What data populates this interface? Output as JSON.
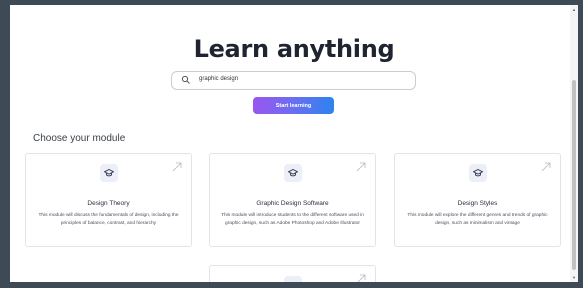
{
  "hero": {
    "title": "Learn anything"
  },
  "search": {
    "value": "graphic design",
    "icon": "search-icon"
  },
  "actions": {
    "start_label": "Start learning"
  },
  "section": {
    "title": "Choose your module"
  },
  "modules": [
    {
      "title": "Design Theory",
      "description": "This module will discuss the fundamentals of design, including the principles of balance, contrast, and hierarchy",
      "icon": "graduation-cap-icon"
    },
    {
      "title": "Graphic Design Software",
      "description": "This module will introduce students to the different software used in graphic design, such as Adobe Photoshop and Adobe Illustrator",
      "icon": "graduation-cap-icon"
    },
    {
      "title": "Design Styles",
      "description": "This module will explore the different genres and trends of graphic design, such as minimalism and vintage",
      "icon": "graduation-cap-icon"
    }
  ],
  "colors": {
    "accent_start": "#9b56f0",
    "accent_end": "#2d83f0",
    "background": "#3f4a57"
  }
}
